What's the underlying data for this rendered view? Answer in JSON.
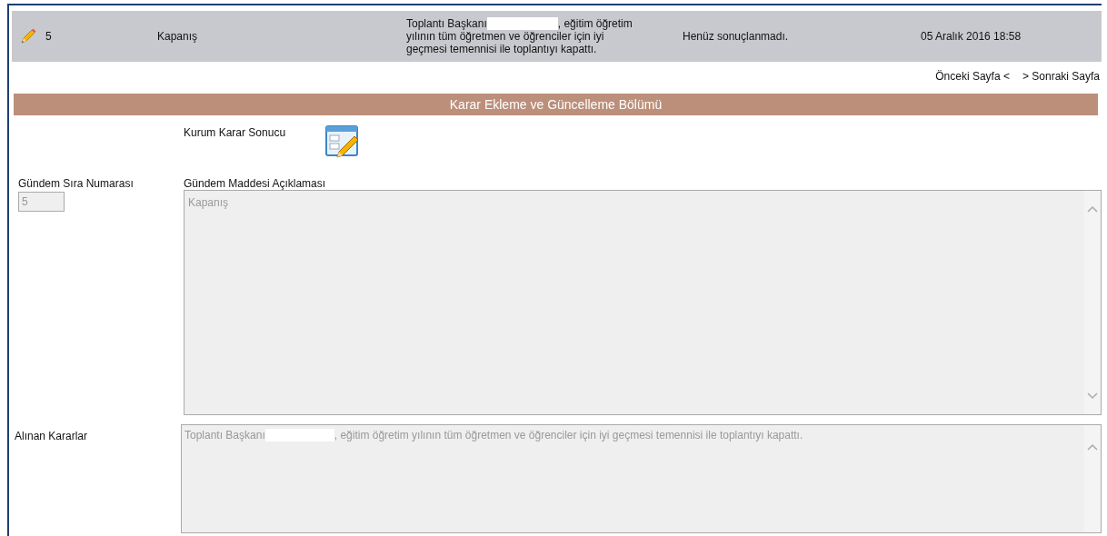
{
  "agenda_row": {
    "number": "5",
    "title": "Kapanış",
    "description_before": "Toplantı Başkanı",
    "description_after": ", eğitim öğretim",
    "description_rest": "yılının tüm öğretmen ve öğrenciler için iyi geçmesi temennisi ile toplantıyı kapattı.",
    "status": "Henüz sonuçlanmadı.",
    "date": "05 Aralık 2016 18:58"
  },
  "pager": {
    "previous": "Önceki Sayfa <",
    "next": "> Sonraki Sayfa"
  },
  "section_title": "Karar Ekleme ve Güncelleme Bölümü",
  "institution_result_label": "Kurum Karar Sonucu",
  "form": {
    "order_label": "Gündem Sıra Numarası",
    "order_value": "5",
    "description_label": "Gündem Maddesi Açıklaması",
    "description_value": "Kapanış",
    "decisions_label": "Alınan Kararlar",
    "decisions_before": "Toplantı Başkanı",
    "decisions_after": ", eğitim öğretim yılının tüm öğretmen ve öğrenciler için iyi geçmesi temennisi ile toplantıyı kapattı."
  }
}
